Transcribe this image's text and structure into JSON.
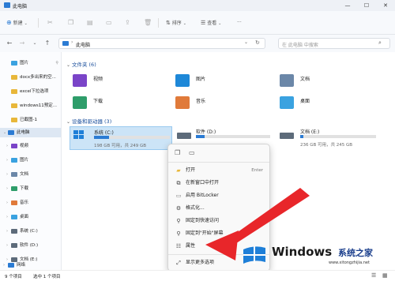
{
  "window": {
    "title": "此电脑",
    "controls": [
      "—",
      "☐",
      "✕"
    ]
  },
  "toolbar": {
    "new_label": "新建",
    "sort_label": "排序",
    "view_label": "查看",
    "more_label": "···"
  },
  "address": {
    "path": "此电脑",
    "search_placeholder": "在 此电脑 中搜索"
  },
  "nav": {
    "items": [
      {
        "label": "图片",
        "pinned": true
      },
      {
        "label": "docx多出来的空...",
        "pinned": false
      },
      {
        "label": "excel下拉选项",
        "pinned": false
      },
      {
        "label": "windows11预定...",
        "pinned": false
      },
      {
        "label": "已截图-1",
        "pinned": false
      },
      {
        "label": "此电脑",
        "selected": true
      },
      {
        "label": "视频"
      },
      {
        "label": "图片"
      },
      {
        "label": "文档"
      },
      {
        "label": "下载"
      },
      {
        "label": "音乐"
      },
      {
        "label": "桌面"
      },
      {
        "label": "系统 (C:)"
      },
      {
        "label": "软件 (D:)"
      },
      {
        "label": "文档 (E:)"
      },
      {
        "label": "网络"
      }
    ]
  },
  "folders": {
    "header": "文件夹 (6)",
    "items": [
      {
        "label": "视频",
        "color": "#7a44c8"
      },
      {
        "label": "图片",
        "color": "#1e88d8"
      },
      {
        "label": "文档",
        "color": "#6b87a8"
      },
      {
        "label": "下载",
        "color": "#2e9d6a"
      },
      {
        "label": "音乐",
        "color": "#e07a3a"
      },
      {
        "label": "桌面",
        "color": "#3aa2e0"
      }
    ]
  },
  "drives": {
    "header": "设备和驱动器 (3)",
    "items": [
      {
        "name": "系统 (C:)",
        "space": "198 GB 可用，共 249 GB",
        "used_fraction": 0.2
      },
      {
        "name": "软件 (D:)",
        "space": "",
        "used_fraction": 0.12
      },
      {
        "name": "文档 (E:)",
        "space": "236 GB 可用，共 245 GB",
        "used_fraction": 0.04
      }
    ]
  },
  "context_menu": {
    "items": [
      {
        "label": "打开",
        "shortcut": "Enter",
        "icon": "open-icon"
      },
      {
        "label": "在新窗口中打开",
        "icon": "new-window-icon"
      },
      {
        "label": "启用 BitLocker",
        "icon": "bitlocker-icon"
      },
      {
        "label": "格式化...",
        "icon": "format-icon"
      },
      {
        "label": "固定到快速访问",
        "icon": "pin-icon"
      },
      {
        "label": "固定到\"开始\"屏幕",
        "icon": "pin-start-icon"
      },
      {
        "label": "属性",
        "icon": "properties-icon"
      },
      {
        "label": "显示更多选项",
        "icon": "more-options-icon"
      }
    ]
  },
  "status": {
    "count": "9 个项目",
    "selected": "选中 1 个项目"
  },
  "watermark": {
    "brand": "Windows",
    "site_cn": "系统之家",
    "url": "www.xitongzhijia.net"
  },
  "colors": {
    "accent": "#0067c0",
    "selection": "#cce4f7",
    "arrow": "#e8262a"
  }
}
